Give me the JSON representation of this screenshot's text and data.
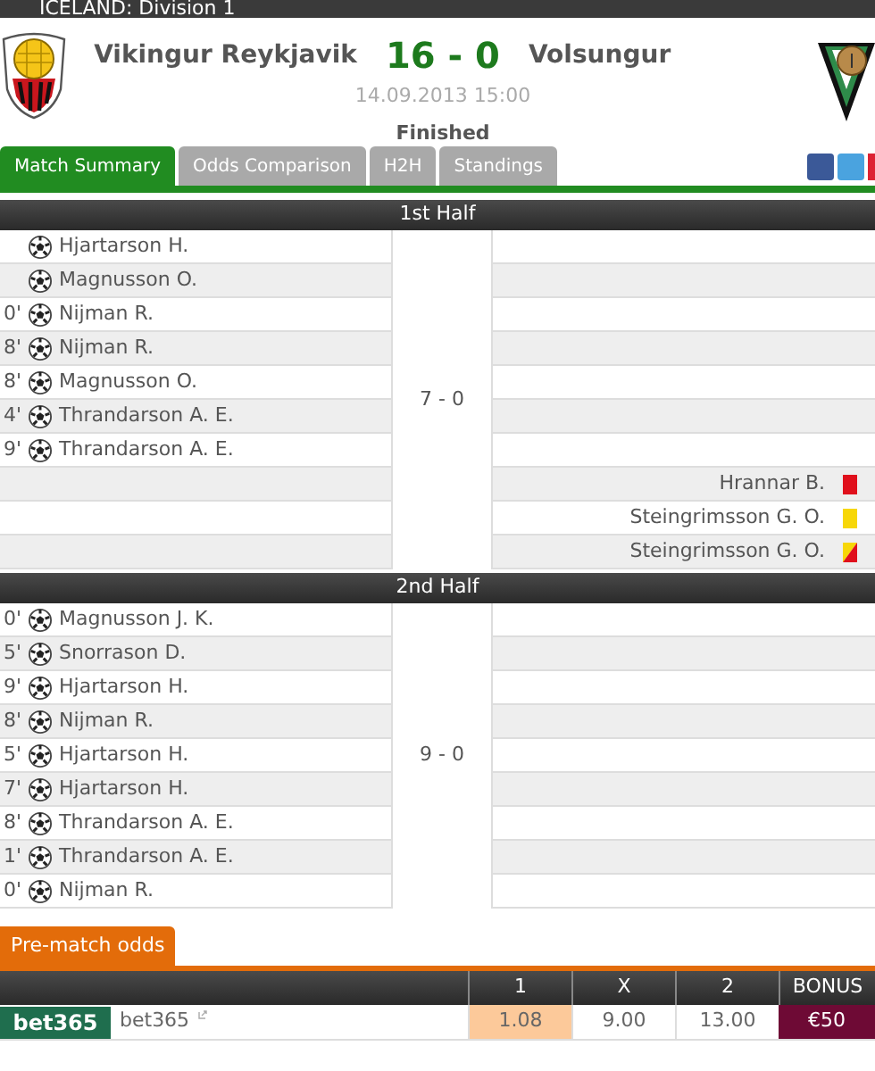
{
  "league": "ICELAND: Division 1",
  "match": {
    "home": "Vikingur Reykjavik",
    "score": "16 - 0",
    "away": "Volsungur",
    "datetime": "14.09.2013 15:00",
    "status": "Finished"
  },
  "tabs": [
    {
      "label": "Match Summary",
      "selected": true
    },
    {
      "label": "Odds Comparison",
      "selected": false
    },
    {
      "label": "H2H",
      "selected": false
    },
    {
      "label": "Standings",
      "selected": false
    }
  ],
  "halves": [
    {
      "title": "1st Half",
      "score": "7 - 0",
      "rows": [
        {
          "home": {
            "kind": "goal",
            "player": "Hjartarson H."
          }
        },
        {
          "home": {
            "kind": "goal",
            "player": "Magnusson O."
          }
        },
        {
          "home": {
            "kind": "goal",
            "minute": "0'",
            "player": "Nijman R."
          }
        },
        {
          "home": {
            "kind": "goal",
            "minute": "8'",
            "player": "Nijman R."
          }
        },
        {
          "home": {
            "kind": "goal",
            "minute": "8'",
            "player": "Magnusson O."
          }
        },
        {
          "home": {
            "kind": "goal",
            "minute": "4'",
            "player": "Thrandarson A. E."
          }
        },
        {
          "home": {
            "kind": "goal",
            "minute": "9'",
            "player": "Thrandarson A. E."
          }
        },
        {
          "away": {
            "kind": "red_card",
            "player": "Hrannar B."
          }
        },
        {
          "away": {
            "kind": "yellow_card",
            "player": "Steingrimsson G. O."
          }
        },
        {
          "away": {
            "kind": "second_yellow",
            "player": "Steingrimsson G. O."
          }
        }
      ]
    },
    {
      "title": "2nd Half",
      "score": "9 - 0",
      "rows": [
        {
          "home": {
            "kind": "goal",
            "minute": "0'",
            "player": "Magnusson J. K."
          }
        },
        {
          "home": {
            "kind": "goal",
            "minute": "5'",
            "player": "Snorrason D."
          }
        },
        {
          "home": {
            "kind": "goal",
            "minute": "9'",
            "player": "Hjartarson H."
          }
        },
        {
          "home": {
            "kind": "goal",
            "minute": "8'",
            "player": "Nijman R."
          }
        },
        {
          "home": {
            "kind": "goal",
            "minute": "5'",
            "player": "Hjartarson H."
          }
        },
        {
          "home": {
            "kind": "goal",
            "minute": "7'",
            "player": "Hjartarson H."
          }
        },
        {
          "home": {
            "kind": "goal",
            "minute": "8'",
            "player": "Thrandarson A. E."
          }
        },
        {
          "home": {
            "kind": "goal",
            "minute": "1'",
            "player": "Thrandarson A. E."
          }
        },
        {
          "home": {
            "kind": "goal",
            "minute": "0'",
            "player": "Nijman R."
          }
        }
      ]
    }
  ],
  "odds": {
    "title": "Pre-match odds",
    "columns": [
      "1",
      "X",
      "2",
      "BONUS"
    ],
    "rows": [
      {
        "logo": "bet365",
        "name": "bet365",
        "odds": [
          {
            "value": "1.08",
            "highlighted": true
          },
          {
            "value": "9.00",
            "highlighted": false
          },
          {
            "value": "13.00",
            "highlighted": false
          }
        ],
        "bonus": "€50"
      }
    ]
  }
}
